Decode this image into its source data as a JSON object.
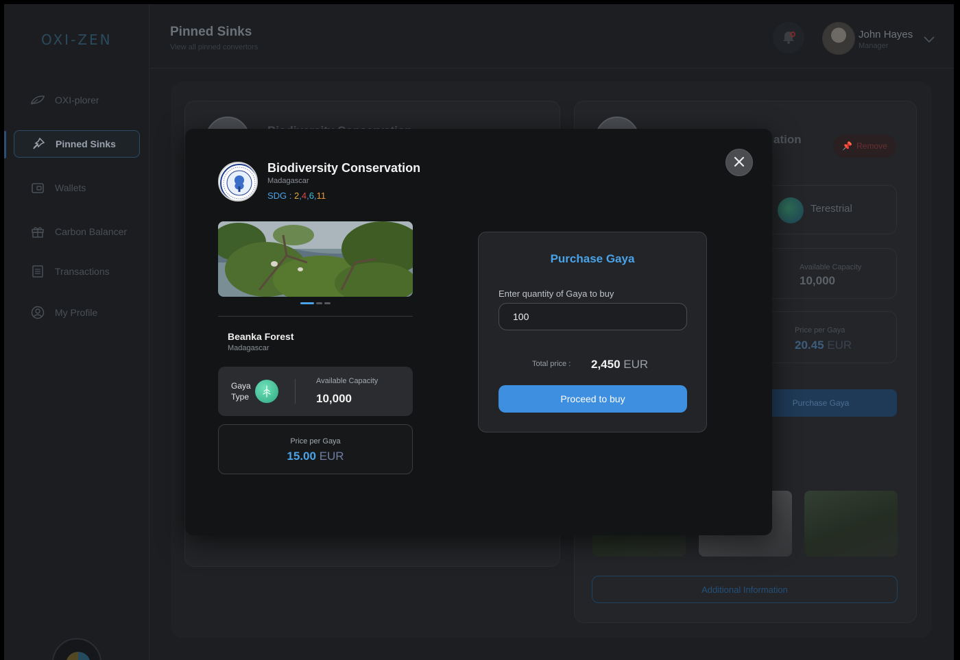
{
  "app": {
    "logo": "OXI-ZEN",
    "nav": [
      {
        "label": "OXI-plorer",
        "icon": "leaf-icon"
      },
      {
        "label": "Pinned Sinks",
        "icon": "pin-icon",
        "active": true
      },
      {
        "label": "Wallets",
        "icon": "wallet-icon"
      },
      {
        "label": "Carbon Balancer",
        "icon": "gift-icon"
      },
      {
        "label": "Transactions",
        "icon": "list-icon"
      },
      {
        "label": "My Profile",
        "icon": "user-circle-icon"
      }
    ]
  },
  "header": {
    "title": "Pinned Sinks",
    "subtitle": "View all pinned convertors",
    "user": {
      "name": "John Hayes",
      "role": "Manager"
    }
  },
  "background_cards": {
    "left_title": "Biodiversity Conservation",
    "right_title_fragment": "ation",
    "remove_label": "Remove",
    "terrain": "Terestrial",
    "capacity_label": "Available Capacity",
    "capacity_value": "10,000",
    "price_label": "Price per Gaya",
    "price_value": "20.45",
    "price_currency": "EUR",
    "purchase_label": "Purchase Gaya",
    "additional_label": "Additional Information"
  },
  "modal": {
    "project_title": "Biodiversity Conservation",
    "project_location": "Madagascar",
    "sdg_label": "SDG : ",
    "sdg_values": [
      {
        "n": "2",
        "color": "#d9a93a"
      },
      {
        "n": "4",
        "color": "#d14a4a"
      },
      {
        "n": "6",
        "color": "#3ec0e0"
      },
      {
        "n": "11",
        "color": "#e89a3a"
      }
    ],
    "forest_name": "Beanka Forest",
    "forest_location": "Madagascar",
    "gaya_type_label_1": "Gaya",
    "gaya_type_label_2": "Type",
    "capacity_label": "Available Capacity",
    "capacity_value": "10,000",
    "price_label": "Price per Gaya",
    "price_value": "15.00",
    "price_currency": "EUR",
    "purchase": {
      "title": "Purchase Gaya",
      "quantity_label": "Enter quantity of Gaya to buy",
      "quantity_value": "100",
      "total_label": "Total price  :",
      "total_value": "2,450",
      "total_currency": "EUR",
      "button_label": "Proceed to buy"
    }
  }
}
